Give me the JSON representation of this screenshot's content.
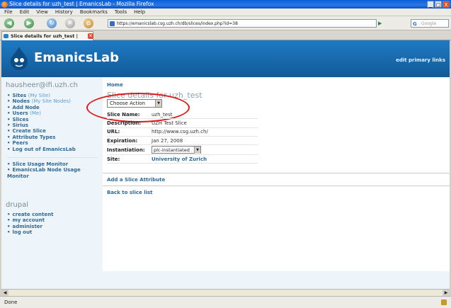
{
  "window": {
    "title": "Slice details for uzh_test | EmanicsLab - Mozilla Firefox",
    "controls": [
      "_",
      "□",
      "X"
    ]
  },
  "menu": [
    "File",
    "Edit",
    "View",
    "History",
    "Bookmarks",
    "Tools",
    "Help"
  ],
  "nav": {
    "url": "https://emanicslab.csg.uzh.ch/db/slices/index.php?id=38",
    "go": "▶",
    "search_placeholder": "Google"
  },
  "tab": {
    "title": "Slice details for uzh_test | Emani..."
  },
  "site": {
    "name": "EmanicsLab",
    "primary_links": "edit primary links"
  },
  "sidebar": {
    "user": "hausheer@ifi.uzh.ch",
    "nav_items": [
      {
        "label": "Sites",
        "sub": "(My Site)"
      },
      {
        "label": "Nodes",
        "sub": "(My Site Nodes)"
      },
      {
        "label": "Add Node",
        "sub": ""
      },
      {
        "label": "Users",
        "sub": "(Me)"
      },
      {
        "label": "Slices",
        "sub": ""
      },
      {
        "label": "Sirius",
        "sub": ""
      },
      {
        "label": "Create Slice",
        "sub": ""
      },
      {
        "label": "Attribute Types",
        "sub": ""
      },
      {
        "label": "Peers",
        "sub": ""
      },
      {
        "label": "Log out of EmanicsLab",
        "sub": ""
      }
    ],
    "monitor_items": [
      "Slice Usage Monitor",
      "EmanicsLab Node Usage Monitor"
    ],
    "drupal_title": "drupal",
    "drupal_items": [
      "create content",
      "my account",
      "administer",
      "log out"
    ]
  },
  "main": {
    "breadcrumb": "Home",
    "title": "Slice details for uzh_test",
    "action_select": "Choose Action",
    "details": {
      "name_label": "Slice Name:",
      "name_value": "uzh_test",
      "desc_label": "Description:",
      "desc_value": "UZH Test Slice",
      "url_label": "URL:",
      "url_value": "http://www.csg.uzh.ch/",
      "exp_label": "Expiration:",
      "exp_value": "Jan 27, 2008",
      "inst_label": "Instantiation:",
      "inst_value": "plc-instantiated",
      "site_label": "Site:",
      "site_value": "University of Zurich"
    },
    "add_attribute": "Add a Slice Attribute",
    "back_link": "Back to slice list"
  },
  "status": {
    "text": "Done"
  },
  "colors": {
    "header_blue": "#1f7ac2",
    "link_blue": "#2f6a98",
    "highlight_red": "#e01818"
  }
}
